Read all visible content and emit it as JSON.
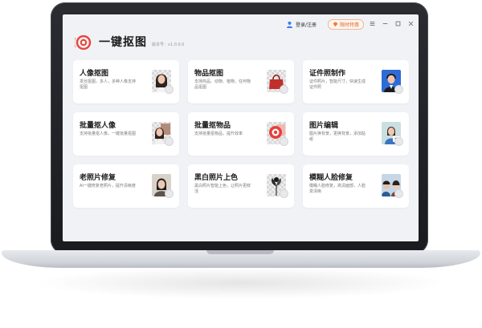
{
  "app": {
    "title": "一键抠图",
    "version": "版本号：v1.0.0.0",
    "brand_color": "#e8453c"
  },
  "titlebar": {
    "login_label": "登录/注册",
    "vip_label": "限时特惠",
    "icons": [
      "user-icon",
      "diamond-icon",
      "menu-icon",
      "minimize-icon",
      "maximize-icon",
      "close-icon"
    ]
  },
  "cards": [
    {
      "title": "人像抠图",
      "desc": "发丝抠图，多人，多种人像支持抠图",
      "thumb_icon": "portrait-icon"
    },
    {
      "title": "物品抠图",
      "desc": "支持商品、动物、植物，任何物品抠图",
      "thumb_icon": "handbag-icon"
    },
    {
      "title": "证件照制作",
      "desc": "证件照片，智能尺寸，快速生成证件照",
      "thumb_icon": "id-photo-icon"
    },
    {
      "title": "批量抠人像",
      "desc": "支持批量抠人像，一键批量抠图",
      "thumb_icon": "portrait-icon"
    },
    {
      "title": "批量抠物品",
      "desc": "支持批量抠物品，提升效率",
      "thumb_icon": "product-icon"
    },
    {
      "title": "图片编辑",
      "desc": "图片换背景，更换背景，添加贴纸",
      "thumb_icon": "photo-edit-icon"
    },
    {
      "title": "老照片修复",
      "desc": "AI一键修复老照片，提升清晰度",
      "thumb_icon": "old-photo-icon"
    },
    {
      "title": "黑白照片上色",
      "desc": "黑白照片智能上色，让照片更鲜活",
      "thumb_icon": "colorize-icon"
    },
    {
      "title": "模糊人脸修复",
      "desc": "模糊人脸修复，高清面部，人脸变清晰",
      "thumb_icon": "face-restore-icon"
    }
  ]
}
